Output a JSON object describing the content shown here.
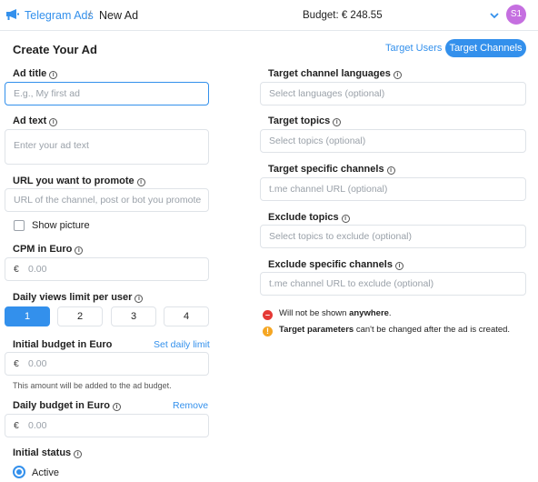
{
  "header": {
    "brand": "Telegram Ads",
    "separator": "/",
    "page": "New Ad",
    "budget": "Budget: € 248.55",
    "avatar": "S1"
  },
  "form": {
    "title": "Create Your Ad",
    "tabs": {
      "users": "Target Users",
      "channels": "Target Channels"
    },
    "ad_title": {
      "label": "Ad title",
      "placeholder": "E.g., My first ad"
    },
    "ad_text": {
      "label": "Ad text",
      "placeholder": "Enter your ad text"
    },
    "url": {
      "label": "URL you want to promote",
      "placeholder": "URL of the channel, post or bot you promote"
    },
    "show_picture": "Show picture",
    "cpm": {
      "label": "CPM in Euro",
      "currency": "€",
      "placeholder": "0.00"
    },
    "daily_views": {
      "label": "Daily views limit per user",
      "options": [
        "1",
        "2",
        "3",
        "4"
      ],
      "selected": "1"
    },
    "initial_budget": {
      "label": "Initial budget in Euro",
      "link": "Set daily limit",
      "currency": "€",
      "placeholder": "0.00",
      "hint": "This amount will be added to the ad budget."
    },
    "daily_budget": {
      "label": "Daily budget in Euro",
      "link": "Remove",
      "currency": "€",
      "placeholder": "0.00"
    },
    "initial_status": {
      "label": "Initial status",
      "option": "Active"
    }
  },
  "targeting": {
    "languages": {
      "label": "Target channel languages",
      "placeholder": "Select languages (optional)"
    },
    "topics": {
      "label": "Target topics",
      "placeholder": "Select topics (optional)"
    },
    "channels": {
      "label": "Target specific channels",
      "placeholder": "t.me channel URL (optional)"
    },
    "exclude_topics": {
      "label": "Exclude topics",
      "placeholder": "Select topics to exclude (optional)"
    },
    "exclude_channels": {
      "label": "Exclude specific channels",
      "placeholder": "t.me channel URL to exclude (optional)"
    },
    "notes": {
      "not_shown_pre": "Will not be shown ",
      "not_shown_bold": "anywhere",
      "not_shown_post": ".",
      "params_bold": "Target parameters",
      "params_post": " can't be changed after the ad is created."
    }
  },
  "colors": {
    "accent": "#3390ec",
    "avatar": "#c56fe0",
    "error": "#e53935",
    "warning": "#f5a623"
  },
  "icons": {
    "brand": "megaphone-icon",
    "menu": "chevron-down-icon",
    "info": "info-icon"
  }
}
